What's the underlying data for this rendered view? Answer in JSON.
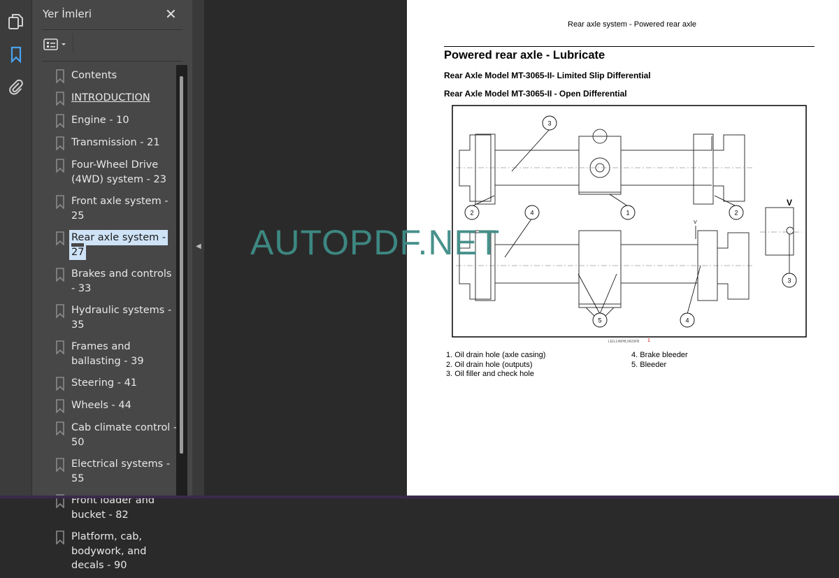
{
  "sidebar": {
    "icons": [
      "pages-icon",
      "bookmark-icon",
      "attachment-icon"
    ],
    "active": "bookmark-icon"
  },
  "bookmarks": {
    "title": "Yer İmleri",
    "close_icon": "close-icon",
    "options_icon": "list-options-icon",
    "items": [
      {
        "label": "Contents"
      },
      {
        "label": "INTRODUCTION",
        "underline": true
      },
      {
        "label": "Engine - 10"
      },
      {
        "label": "Transmission - 21"
      },
      {
        "label": "Four-Wheel Drive (4WD) system - 23"
      },
      {
        "label": "Front axle system - 25"
      },
      {
        "label": "Rear axle system - 27",
        "selected": true
      },
      {
        "label": "Brakes and controls - 33"
      },
      {
        "label": "Hydraulic systems - 35"
      },
      {
        "label": "Frames and ballasting - 39"
      },
      {
        "label": "Steering - 41"
      },
      {
        "label": "Wheels - 44"
      },
      {
        "label": "Cab climate control - 50"
      },
      {
        "label": "Electrical systems - 55"
      },
      {
        "label": "Front loader and bucket - 82"
      },
      {
        "label": "Platform, cab, bodywork, and decals - 90"
      }
    ]
  },
  "watermark": "AUTOPDF.NET",
  "document": {
    "running_header": "Rear axle system - Powered rear axle",
    "title": "Powered rear axle - Lubricate",
    "subtitles": [
      "Rear Axle Model MT-3065-II- Limited Slip Differential",
      "Rear Axle Model MT-3065-II - Open Differential"
    ],
    "figure": {
      "code": "LEIL14WHL0423FB",
      "number": "1",
      "view_label": "V",
      "callouts": [
        "3",
        "2",
        "1",
        "2",
        "4",
        "3",
        "5",
        "4"
      ]
    },
    "legend_left": [
      "1. Oil drain hole (axle casing)",
      "2. Oil drain hole (outputs)",
      "3. Oil filler and check hole"
    ],
    "legend_right": [
      "4. Brake bleeder",
      "5. Bleeder"
    ]
  },
  "colors": {
    "accent": "#4aa3f0",
    "watermark": "#3f8c86",
    "selection": "#cfe3f7"
  }
}
